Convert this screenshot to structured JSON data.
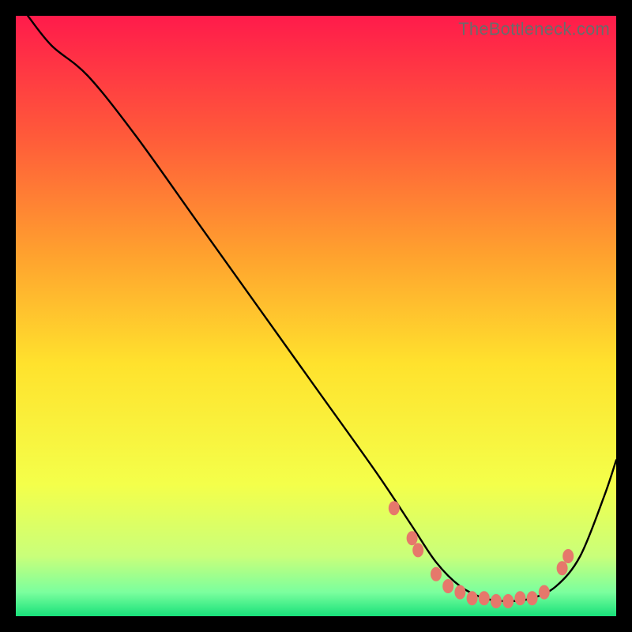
{
  "watermark": "TheBottleneck.com",
  "chart_data": {
    "type": "line",
    "title": "",
    "xlabel": "",
    "ylabel": "",
    "xlim": [
      0,
      100
    ],
    "ylim": [
      0,
      100
    ],
    "grid": false,
    "legend": false,
    "annotations": [],
    "background_gradient": {
      "type": "vertical",
      "stops": [
        {
          "pos": 0.0,
          "color": "#ff1b4b"
        },
        {
          "pos": 0.2,
          "color": "#ff5a3a"
        },
        {
          "pos": 0.4,
          "color": "#ffa22e"
        },
        {
          "pos": 0.58,
          "color": "#ffe22d"
        },
        {
          "pos": 0.78,
          "color": "#f4ff4a"
        },
        {
          "pos": 0.9,
          "color": "#c9ff7a"
        },
        {
          "pos": 0.96,
          "color": "#7bff9e"
        },
        {
          "pos": 1.0,
          "color": "#18e07a"
        }
      ]
    },
    "series": [
      {
        "name": "curve",
        "color": "#000000",
        "x": [
          2,
          6,
          12,
          20,
          30,
          40,
          50,
          60,
          66,
          70,
          74,
          78,
          82,
          86,
          90,
          94,
          98,
          100
        ],
        "y": [
          100,
          95,
          90,
          80,
          66,
          52,
          38,
          24,
          15,
          9,
          5,
          3,
          2.5,
          3,
          5,
          10,
          20,
          26
        ]
      }
    ],
    "markers": {
      "name": "bead-cluster",
      "color": "#e6786b",
      "points": [
        {
          "x": 63,
          "y": 18
        },
        {
          "x": 66,
          "y": 13
        },
        {
          "x": 67,
          "y": 11
        },
        {
          "x": 70,
          "y": 7
        },
        {
          "x": 72,
          "y": 5
        },
        {
          "x": 74,
          "y": 4
        },
        {
          "x": 76,
          "y": 3
        },
        {
          "x": 78,
          "y": 3
        },
        {
          "x": 80,
          "y": 2.5
        },
        {
          "x": 82,
          "y": 2.5
        },
        {
          "x": 84,
          "y": 3
        },
        {
          "x": 86,
          "y": 3
        },
        {
          "x": 88,
          "y": 4
        },
        {
          "x": 91,
          "y": 8
        },
        {
          "x": 92,
          "y": 10
        }
      ]
    }
  }
}
